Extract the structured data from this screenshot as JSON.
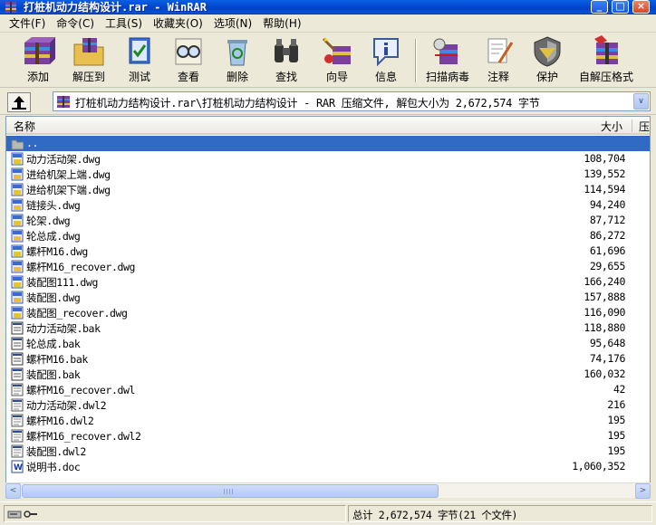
{
  "window": {
    "title": "打桩机动力结构设计.rar - WinRAR",
    "minimize_glyph": "_",
    "maximize_glyph": "□",
    "close_glyph": "×"
  },
  "menu": [
    "文件(F)",
    "命令(C)",
    "工具(S)",
    "收藏夹(O)",
    "选项(N)",
    "帮助(H)"
  ],
  "toolbar": {
    "add": "添加",
    "extract": "解压到",
    "test": "测试",
    "view": "查看",
    "delete": "删除",
    "find": "查找",
    "wizard": "向导",
    "info": "信息",
    "virus_scan": "扫描病毒",
    "comment": "注释",
    "protect": "保护",
    "sfx": "自解压格式"
  },
  "address": {
    "path": "打桩机动力结构设计.rar\\打桩机动力结构设计 - RAR 压缩文件, 解包大小为 2,672,574 字节",
    "dropdown_glyph": "∨"
  },
  "columns": {
    "name": "名称",
    "size": "大小",
    "packed": "压"
  },
  "files": [
    {
      "name": "..",
      "size": "",
      "icon": "folder-up-icon",
      "selected": true
    },
    {
      "name": "动力活动架.dwg",
      "size": "108,704",
      "icon": "dwg-file-icon"
    },
    {
      "name": "进给机架上端.dwg",
      "size": "139,552",
      "icon": "dwg-file-icon"
    },
    {
      "name": "进给机架下端.dwg",
      "size": "114,594",
      "icon": "dwg-file-icon"
    },
    {
      "name": "链接头.dwg",
      "size": "94,240",
      "icon": "dwg-file-icon"
    },
    {
      "name": "轮架.dwg",
      "size": "87,712",
      "icon": "dwg-file-icon"
    },
    {
      "name": "轮总成.dwg",
      "size": "86,272",
      "icon": "dwg-file-icon"
    },
    {
      "name": "螺杆M16.dwg",
      "size": "61,696",
      "icon": "dwg-file-icon"
    },
    {
      "name": "螺杆M16_recover.dwg",
      "size": "29,655",
      "icon": "dwg-file-icon"
    },
    {
      "name": "装配图111.dwg",
      "size": "166,240",
      "icon": "dwg-file-icon"
    },
    {
      "name": "装配图.dwg",
      "size": "157,888",
      "icon": "dwg-file-icon"
    },
    {
      "name": "装配图_recover.dwg",
      "size": "116,090",
      "icon": "dwg-file-icon"
    },
    {
      "name": "动力活动架.bak",
      "size": "118,880",
      "icon": "bak-file-icon"
    },
    {
      "name": "轮总成.bak",
      "size": "95,648",
      "icon": "bak-file-icon"
    },
    {
      "name": "螺杆M16.bak",
      "size": "74,176",
      "icon": "bak-file-icon"
    },
    {
      "name": "装配图.bak",
      "size": "160,032",
      "icon": "bak-file-icon"
    },
    {
      "name": "螺杆M16_recover.dwl",
      "size": "42",
      "icon": "dwl-file-icon"
    },
    {
      "name": "动力活动架.dwl2",
      "size": "216",
      "icon": "dwl-file-icon"
    },
    {
      "name": "螺杆M16.dwl2",
      "size": "195",
      "icon": "dwl-file-icon"
    },
    {
      "name": "螺杆M16_recover.dwl2",
      "size": "195",
      "icon": "dwl-file-icon"
    },
    {
      "name": "装配图.dwl2",
      "size": "195",
      "icon": "dwl-file-icon"
    },
    {
      "name": "说明书.doc",
      "size": "1,060,352",
      "icon": "word-doc-icon"
    }
  ],
  "scrollbar": {
    "left_glyph": "<",
    "right_glyph": ">"
  },
  "status": {
    "summary": "总计 2,672,574 字节(21 个文件)"
  },
  "colors": {
    "titlebar": "#0a5fe3",
    "selection": "#316ac5",
    "face": "#ece9d8"
  }
}
